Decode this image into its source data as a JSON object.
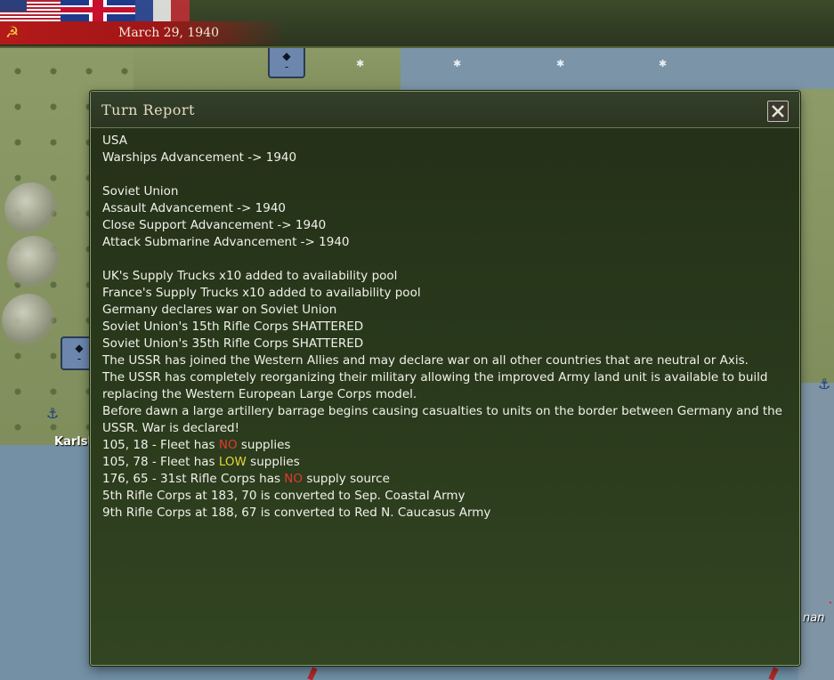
{
  "header": {
    "date": "March 29, 1940",
    "flags": [
      "USA",
      "UK",
      "France"
    ],
    "current_side_icon": "hammer-and-sickle-icon"
  },
  "map": {
    "town_label": "Karlskr",
    "right_label": "nan"
  },
  "dialog": {
    "title": "Turn Report",
    "close_icon": "close-icon",
    "lines": [
      {
        "text": "USA"
      },
      {
        "text": "Warships Advancement -> 1940"
      },
      {
        "text": ""
      },
      {
        "text": "Soviet Union"
      },
      {
        "text": "Assault Advancement -> 1940"
      },
      {
        "text": "Close Support Advancement -> 1940"
      },
      {
        "text": "Attack Submarine Advancement -> 1940"
      },
      {
        "text": ""
      },
      {
        "text": "UK's Supply Trucks x10 added to availability pool"
      },
      {
        "text": "France's Supply Trucks x10 added to availability pool"
      },
      {
        "text": "Germany declares war on Soviet Union"
      },
      {
        "text": "Soviet Union's 15th Rifle Corps SHATTERED"
      },
      {
        "text": "Soviet Union's 35th Rifle Corps SHATTERED"
      },
      {
        "text": "The USSR has joined the Western Allies and may declare war on all other countries that are neutral or Axis."
      },
      {
        "text": "The USSR has completely reorganizing their military allowing the improved Army land unit is available to build replacing the Western European Large Corps model."
      },
      {
        "text": "Before dawn a large artillery barrage begins causing casualties to units on the border between Germany and the USSR. War is declared!"
      }
    ],
    "supply_lines": [
      {
        "before": "105, 18 - Fleet has ",
        "status": "NO",
        "after": " supplies",
        "color": "#e03b2e"
      },
      {
        "before": "105, 78 - Fleet has ",
        "status": "LOW",
        "after": " supplies",
        "color": "#e4d53a"
      },
      {
        "before": "176, 65 - 31st Rifle Corps has ",
        "status": "NO",
        "after": " supply source",
        "color": "#e03b2e"
      }
    ],
    "final_lines": [
      {
        "text": "5th Rifle Corps at 183, 70 is converted to Sep. Coastal Army"
      },
      {
        "text": "9th Rifle Corps at 188, 67 is converted to Red N. Caucasus Army"
      }
    ]
  }
}
